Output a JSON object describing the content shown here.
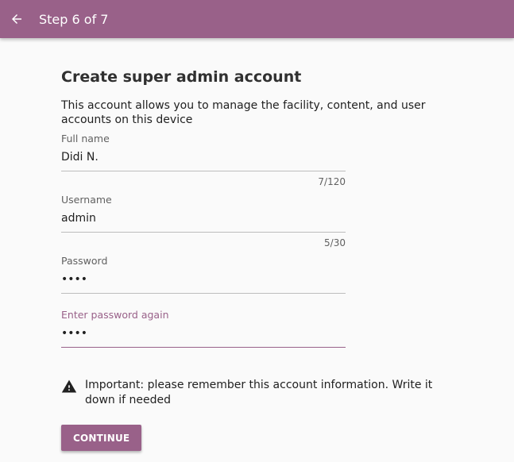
{
  "header": {
    "title": "Step 6 of 7",
    "back_icon": "arrow-left-icon"
  },
  "main": {
    "title": "Create super admin account",
    "description": "This account allows you to manage the facility, content, and user accounts on this device"
  },
  "form": {
    "full_name": {
      "label": "Full name",
      "value": "Didi N.",
      "counter": "7/120"
    },
    "username": {
      "label": "Username",
      "value": "admin",
      "counter": "5/30"
    },
    "password": {
      "label": "Password",
      "value": "••••"
    },
    "password_confirm": {
      "label": "Enter password again",
      "value": "••••"
    }
  },
  "warning": {
    "icon": "warning-triangle-icon",
    "text": "Important: please remember this account information. Write it down if needed"
  },
  "actions": {
    "continue_label": "CONTINUE"
  },
  "colors": {
    "brand": "#996189",
    "background": "#fafafa",
    "text": "#212121"
  }
}
